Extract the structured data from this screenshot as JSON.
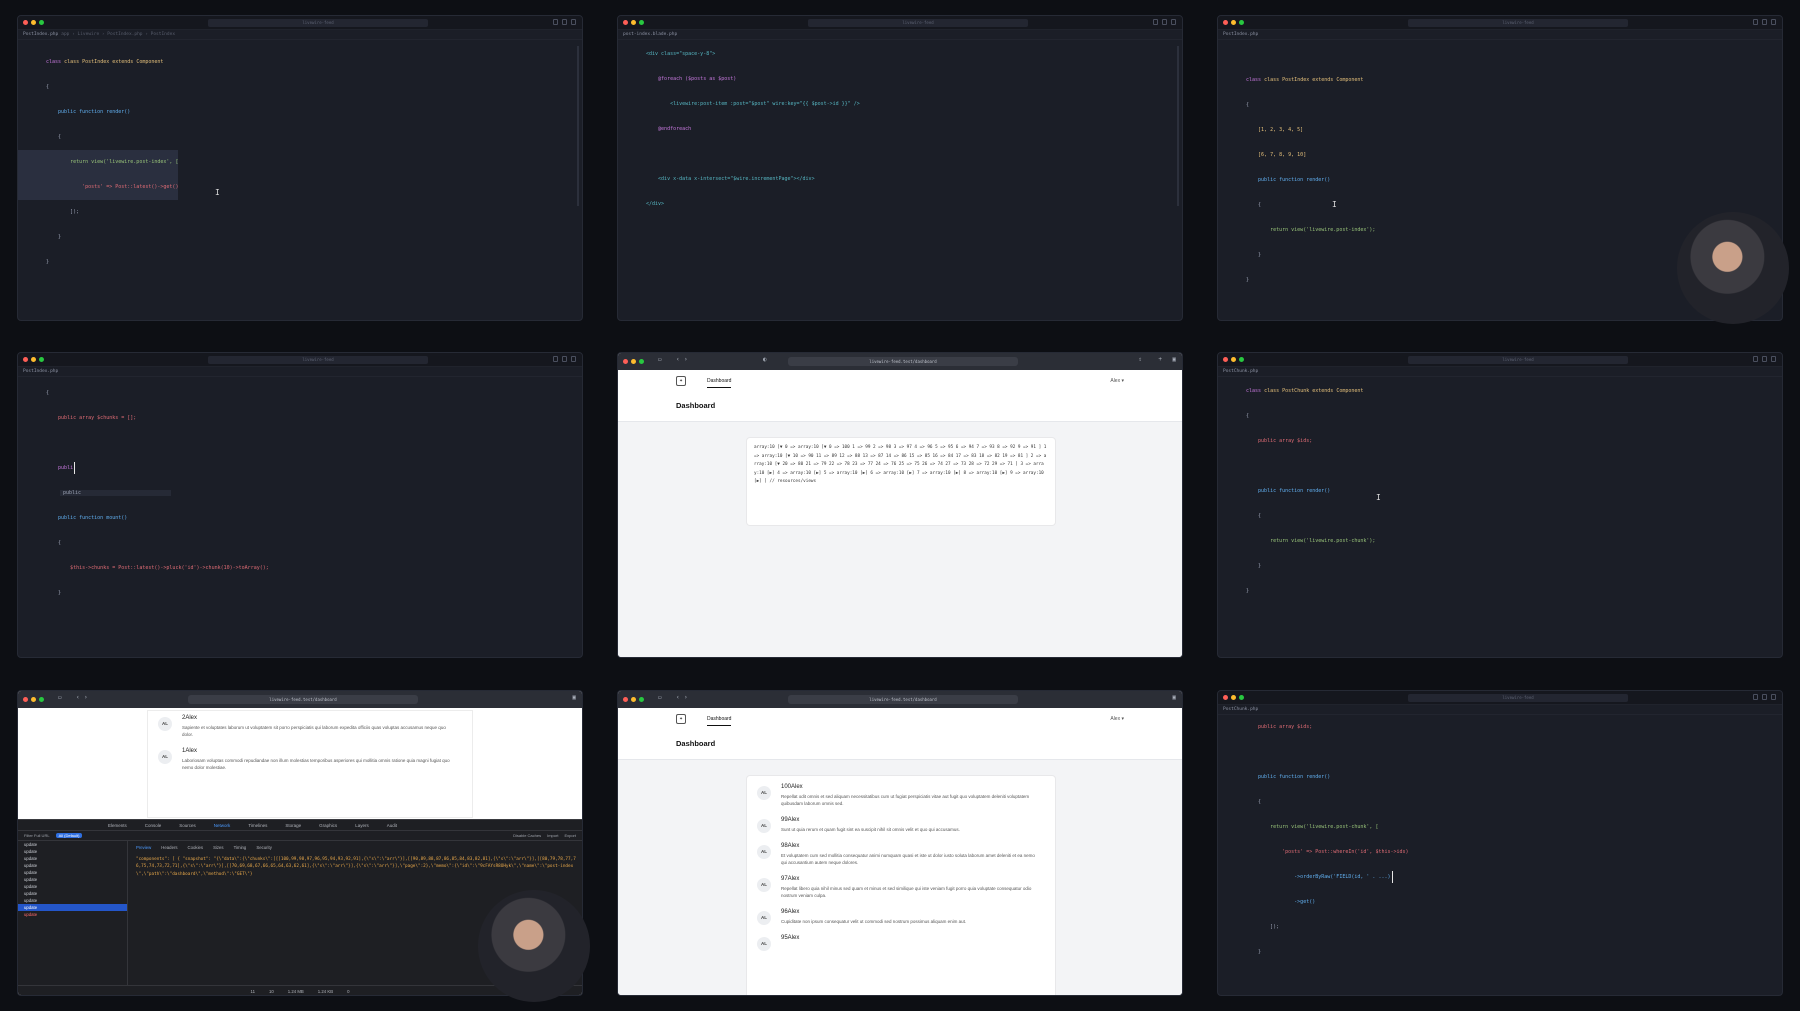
{
  "editor": {
    "search_placeholder": "livewire-feed",
    "file_index": "PostIndex.php",
    "file_blade": "post-index.blade.php",
    "file_chunk": "PostChunk.php",
    "crumb": "app › Livewire › PostIndex.php › PostIndex"
  },
  "p1": [
    "class PostIndex extends Component",
    "{",
    "    public function render()",
    "    {",
    "        return view('livewire.post-index', [",
    "            'posts' => Post::latest()->get()",
    "        ]);",
    "    }",
    "}"
  ],
  "p2": [
    "<div class=\"space-y-8\">",
    "    @foreach ($posts as $post)",
    "        <livewire:post-item :post=\"$post\" wire:key=\"{{ $post->id }}\" />",
    "    @endforeach",
    "",
    "    <div x-data x-intersect=\"$wire.incrementPage\"></div>",
    "</div>"
  ],
  "p3": [
    "class PostIndex extends Component",
    "{",
    "    [1, 2, 3, 4, 5]",
    "    [6, 7, 8, 9, 10]",
    "    public function render()",
    "    {",
    "        return view('livewire.post-index');",
    "    }",
    "}"
  ],
  "p4": [
    "{",
    "    public array $chunks = [];",
    "",
    "    publi",
    "",
    "    public function mount()",
    "    {",
    "        $this->chunks = Post::latest()->pluck('id')->chunk(10)->toArray();",
    "    }"
  ],
  "p4_suggest": "public",
  "p6": [
    "class PostChunk extends Component",
    "{",
    "    public array $ids;",
    "",
    "    public function render()",
    "    {",
    "        return view('livewire.post-chunk');",
    "    }",
    "}"
  ],
  "p9": [
    "    public array $ids;",
    "",
    "    public function render()",
    "    {",
    "        return view('livewire.post-chunk', [",
    "            'posts' => Post::whereIn('id', $this->ids)",
    "                ->orderByRaw('FIELD(id, ' . ...)",
    "                ->get()",
    "        ]);",
    "    }"
  ],
  "browser": {
    "url": "livewire-feed.test/dashboard",
    "nav": "Dashboard",
    "user": "Alex",
    "title": "Dashboard",
    "dump": "array:10 [▼ 0 => array:10 [▼ 0 => 100 1 => 99 2 => 98 3 => 97 4 => 96 5 => 95 6 => 94 7 => 93 8 => 92 9 => 91 ] 1 => array:10 [▼ 10 => 90 11 => 89 12 => 88 13 => 87 14 => 86 15 => 85 16 => 84 17 => 83 18 => 82 19 => 81 ] 2 => array:10 [▼ 20 => 80 21 => 79 22 => 78 23 => 77 24 => 76 25 => 75 26 => 74 27 => 73 28 => 72 29 => 71 ] 3 => array:10 [▶] 4 => array:10 [▶] 5 => array:10 [▶] 6 => array:10 [▶] 7 => array:10 [▶] 8 => array:10 [▶] 9 => array:10 [▶] ] // resources/views"
  },
  "p7_posts": [
    {
      "av": "AL",
      "name": "2Alex",
      "body": "Sapiente et voluptates laborum ut voluptatem sit porro perspiciatis qui laborum expedita officiis quas voluptas accusamus neque quo dolor."
    },
    {
      "av": "AL",
      "name": "1Alex",
      "body": "Laboriosam voluptas commodi repudiandae non illum molestias temporibus asperiores qui mollitia omnis ratione quia magni fugiat quo nemo dolor molestiae."
    }
  ],
  "p8_posts": [
    {
      "av": "AL",
      "name": "100Alex",
      "body": "Repellat odit omnis et sed aliquam necessitatibus cum ut fugiat perspiciatis vitae aut fugit quo voluptatem deleniti voluptatem quibusdam laborum omnis sed."
    },
    {
      "av": "AL",
      "name": "99Alex",
      "body": "Sunt ut quia rerum et quam fugit sint ea suscipit nihil sit omnis velit et quo qui accusamus."
    },
    {
      "av": "AL",
      "name": "98Alex",
      "body": "Et voluptatem cum sed mollitia consequatur animi numquam quasi et iste ut dolor iusto soluta laborum amet deleniti et ea nemo qui accusantium autem neque dolores."
    },
    {
      "av": "AL",
      "name": "97Alex",
      "body": "Repellat libero quia nihil minus sed quam et minus et sed similique qui iste veniam fugit porro quia voluptate consequatur odio nostrum veniam culpa."
    },
    {
      "av": "AL",
      "name": "96Alex",
      "body": "Cupiditate non ipsum consequatur velit ut commodi sed nostrum possimus aliquam enim aut."
    },
    {
      "av": "AL",
      "name": "95Alex",
      "body": ""
    }
  ],
  "devtools": {
    "tabs": [
      "Elements",
      "Console",
      "Sources",
      "Network",
      "Timelines",
      "Storage",
      "Graphics",
      "Layers",
      "Audit"
    ],
    "filter": "Filter Full URL",
    "filter_pill": "All (Default)",
    "right_opts": [
      "Disable Caches",
      "Import",
      "Export"
    ],
    "payload_tabs": [
      "Preview",
      "Headers",
      "Cookies",
      "Sizes",
      "Timing",
      "Security"
    ],
    "requests": [
      "update",
      "update",
      "update",
      "update",
      "update",
      "update",
      "update",
      "update",
      "update",
      "update",
      "update"
    ],
    "payload": "\"components\": [ { \"snapshot\": \"{\\\"data\\\":{\\\"chunks\\\":[[[100,99,98,97,96,95,94,93,92,91],{\\\"s\\\":\\\"arr\\\"}],[[90,89,88,87,86,85,84,83,82,81],{\\\"s\\\":\\\"arr\\\"}],[[80,79,78,77,76,75,74,73,72,71],{\\\"s\\\":\\\"arr\\\"}],[[70,69,68,67,66,65,64,63,62,61],{\\\"s\\\":\\\"arr\\\"}],{\\\"s\\\":\\\"arr\\\"}],\\\"page\\\":2},\\\"memo\\\":{\\\"id\\\":\\\"9cFAYsR8OHyk\\\",\\\"name\\\":\\\"post-index\\\",\\\"path\\\":\\\"dashboard\\\",\\\"method\\\":\\\"GET\\\"}",
    "status": [
      "11",
      "10",
      "1.24 MB",
      "1.24 KB",
      "0"
    ]
  }
}
